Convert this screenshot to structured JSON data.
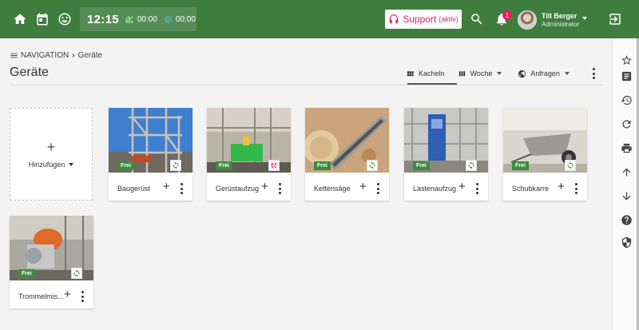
{
  "topbar": {
    "icons": [
      "home-icon",
      "calendar-icon",
      "smiley-icon"
    ],
    "clock": {
      "time": "12:15",
      "work_time": "00:00",
      "break_time": "00:00"
    },
    "support": {
      "label": "Support",
      "sub": "(aktiv)"
    },
    "notifications": {
      "count": "1"
    },
    "user": {
      "name": "Till Berger",
      "role": "Administrator"
    },
    "colors": {
      "bar": "#3f7d3f",
      "support": "#e0245e"
    }
  },
  "breadcrumb": {
    "root": "NAVIGATION",
    "current": "Geräte"
  },
  "page": {
    "title": "Geräte"
  },
  "views": [
    {
      "label": "Kacheln",
      "icon": "grid-icon"
    },
    {
      "label": "Woche",
      "icon": "week-icon"
    },
    {
      "label": "Anfragen",
      "icon": "globe-icon"
    }
  ],
  "add_tile": {
    "label": "Hinzufügen"
  },
  "tiles": [
    {
      "name": "Baugerüst",
      "status": "Frei",
      "sync": "synced"
    },
    {
      "name": "Gerüstaufzug",
      "status": "Frei",
      "sync": "sync-off"
    },
    {
      "name": "Kettensäge",
      "status": "Frei",
      "sync": "synced"
    },
    {
      "name": "Lastenaufzug",
      "status": "Frei",
      "sync": "synced"
    },
    {
      "name": "Schubkarre",
      "status": "Frei",
      "sync": "synced"
    },
    {
      "name": "Trommelmis...",
      "status": "Frei",
      "sync": "synced"
    }
  ],
  "rail_icons": [
    "star-icon",
    "notes-icon",
    "history-icon",
    "refresh-icon",
    "print-icon",
    "arrow-up-icon",
    "arrow-down-icon",
    "help-icon",
    "shield-icon"
  ]
}
